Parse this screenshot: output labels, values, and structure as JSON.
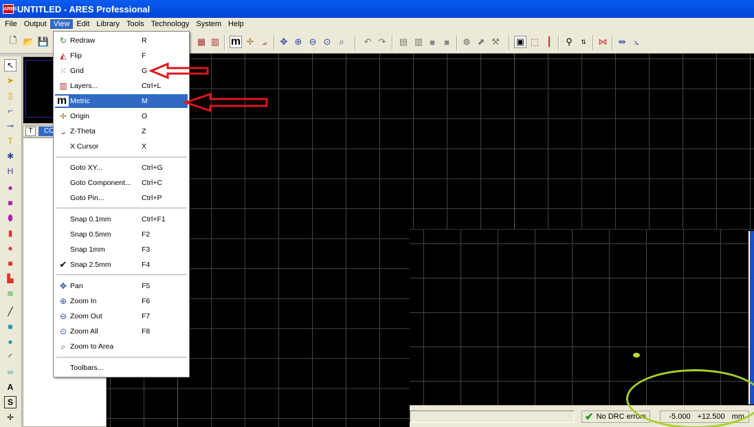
{
  "window": {
    "title": "UNTITLED - ARES Professional",
    "app_icon_text": "ARES"
  },
  "menubar": [
    "File",
    "Output",
    "View",
    "Edit",
    "Library",
    "Tools",
    "Technology",
    "System",
    "Help"
  ],
  "view_menu": {
    "items": [
      {
        "label": "Redraw",
        "shortcut": "R",
        "icon": "redraw-icon"
      },
      {
        "label": "Flip",
        "shortcut": "F",
        "icon": "flip-icon"
      },
      {
        "label": "Grid",
        "shortcut": "G",
        "icon": "grid-icon"
      },
      {
        "label": "Layers...",
        "shortcut": "Ctrl+L",
        "icon": "layers-icon"
      },
      {
        "label": "Metric",
        "shortcut": "M",
        "icon": "metric-icon",
        "highlighted": true
      },
      {
        "label": "Origin",
        "shortcut": "O",
        "icon": "origin-icon"
      },
      {
        "label": "Z-Theta",
        "shortcut": "Z",
        "icon": "z-theta-icon"
      },
      {
        "label": "X Cursor",
        "shortcut": "X",
        "icon": ""
      },
      {
        "label": "Goto XY...",
        "shortcut": "Ctrl+G",
        "icon": ""
      },
      {
        "label": "Goto Component...",
        "shortcut": "Ctrl+C",
        "icon": ""
      },
      {
        "label": "Goto Pin...",
        "shortcut": "Ctrl+P",
        "icon": ""
      },
      {
        "label": "Snap 0.1mm",
        "shortcut": "Ctrl+F1",
        "icon": ""
      },
      {
        "label": "Snap 0.5mm",
        "shortcut": "F2",
        "icon": ""
      },
      {
        "label": "Snap 1mm",
        "shortcut": "F3",
        "icon": ""
      },
      {
        "label": "Snap 2.5mm",
        "shortcut": "F4",
        "icon": "checkmark-icon",
        "checked": true
      },
      {
        "label": "Pan",
        "shortcut": "F5",
        "icon": "pan-icon"
      },
      {
        "label": "Zoom In",
        "shortcut": "F6",
        "icon": "zoom-in-icon"
      },
      {
        "label": "Zoom Out",
        "shortcut": "F7",
        "icon": "zoom-out-icon"
      },
      {
        "label": "Zoom All",
        "shortcut": "F8",
        "icon": "zoom-all-icon"
      },
      {
        "label": "Zoom to Area",
        "shortcut": "",
        "icon": "zoom-area-icon"
      },
      {
        "label": "Toolbars...",
        "shortcut": "",
        "icon": ""
      }
    ]
  },
  "side_panel": {
    "tab_t": "T",
    "tab_label": "CO"
  },
  "status": {
    "drc_text": "No DRC errors",
    "x": "-5.000",
    "y": "+12.500",
    "units": "mm"
  },
  "colors": {
    "annotation_arrow": "#e0141b",
    "highlight_ellipse": "#a6cf2a",
    "menu_highlight": "#316ac5",
    "title_bar": "#0a5cf0"
  }
}
